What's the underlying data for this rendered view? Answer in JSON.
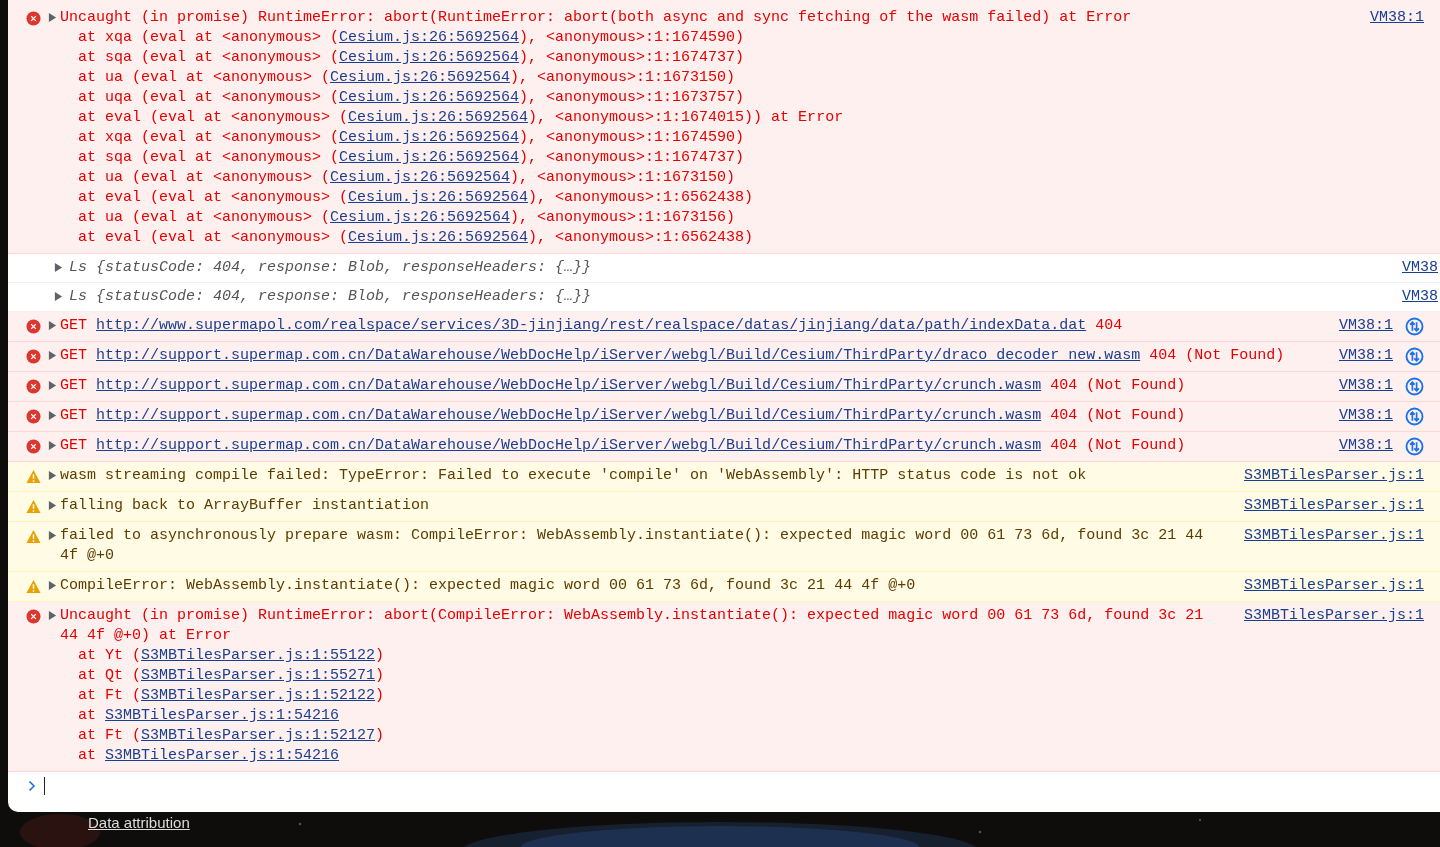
{
  "console": {
    "entries": [
      {
        "kind": "error",
        "message": "Uncaught (in promise) RuntimeError: abort(RuntimeError: abort(both async and sync fetching of the wasm failed) at Error",
        "source": "VM38:1",
        "stack": [
          {
            "prefix": "at xqa (eval at <anonymous> (",
            "link": "Cesium.js:26:5692564",
            "suffix": "), <anonymous>:1:1674590)"
          },
          {
            "prefix": "at sqa (eval at <anonymous> (",
            "link": "Cesium.js:26:5692564",
            "suffix": "), <anonymous>:1:1674737)"
          },
          {
            "prefix": "at ua (eval at <anonymous> (",
            "link": "Cesium.js:26:5692564",
            "suffix": "), <anonymous>:1:1673150)"
          },
          {
            "prefix": "at uqa (eval at <anonymous> (",
            "link": "Cesium.js:26:5692564",
            "suffix": "), <anonymous>:1:1673757)"
          },
          {
            "prefix": "at eval (eval at <anonymous> (",
            "link": "Cesium.js:26:5692564",
            "suffix": "), <anonymous>:1:1674015)) at Error"
          },
          {
            "prefix": "at xqa (eval at <anonymous> (",
            "link": "Cesium.js:26:5692564",
            "suffix": "), <anonymous>:1:1674590)"
          },
          {
            "prefix": "at sqa (eval at <anonymous> (",
            "link": "Cesium.js:26:5692564",
            "suffix": "), <anonymous>:1:1674737)"
          },
          {
            "prefix": "at ua (eval at <anonymous> (",
            "link": "Cesium.js:26:5692564",
            "suffix": "), <anonymous>:1:1673150)"
          },
          {
            "prefix": "at eval (eval at <anonymous> (",
            "link": "Cesium.js:26:5692564",
            "suffix": "), <anonymous>:1:6562438)"
          },
          {
            "prefix": "at ua (eval at <anonymous> (",
            "link": "Cesium.js:26:5692564",
            "suffix": "), <anonymous>:1:1673156)"
          },
          {
            "prefix": "at eval (eval at <anonymous> (",
            "link": "Cesium.js:26:5692564",
            "suffix": "), <anonymous>:1:6562438)"
          }
        ]
      },
      {
        "kind": "log",
        "message": "Ls {statusCode: 404, response: Blob, responseHeaders: {…}}",
        "source": "VM38"
      },
      {
        "kind": "log",
        "message": "Ls {statusCode: 404, response: Blob, responseHeaders: {…}}",
        "source": "VM38"
      },
      {
        "kind": "network",
        "method": "GET",
        "url": "http://www.supermapol.com/realspace/services/3D-jinjiang/rest/realspace/datas/jinjiang/data/path/indexData.dat",
        "status": "404",
        "source": "VM38:1"
      },
      {
        "kind": "network",
        "method": "GET",
        "url": "http://support.supermap.com.cn/DataWarehouse/WebDocHelp/iServer/webgl/Build/Cesium/ThirdParty/draco_decoder_new.wasm",
        "status": "404 (Not Found)",
        "source": "VM38:1"
      },
      {
        "kind": "network",
        "method": "GET",
        "url": "http://support.supermap.com.cn/DataWarehouse/WebDocHelp/iServer/webgl/Build/Cesium/ThirdParty/crunch.wasm",
        "status": "404 (Not Found)",
        "source": "VM38:1"
      },
      {
        "kind": "network",
        "method": "GET",
        "url": "http://support.supermap.com.cn/DataWarehouse/WebDocHelp/iServer/webgl/Build/Cesium/ThirdParty/crunch.wasm",
        "status": "404 (Not Found)",
        "source": "VM38:1"
      },
      {
        "kind": "network",
        "method": "GET",
        "url": "http://support.supermap.com.cn/DataWarehouse/WebDocHelp/iServer/webgl/Build/Cesium/ThirdParty/crunch.wasm",
        "status": "404 (Not Found)",
        "source": "VM38:1"
      },
      {
        "kind": "warning",
        "message": "wasm streaming compile failed: TypeError: Failed to execute 'compile' on 'WebAssembly': HTTP status code is not ok",
        "source": "S3MBTilesParser.js:1"
      },
      {
        "kind": "warning",
        "message": "falling back to ArrayBuffer instantiation",
        "source": "S3MBTilesParser.js:1"
      },
      {
        "kind": "warning",
        "message": "failed to asynchronously prepare wasm: CompileError: WebAssembly.instantiate(): expected magic word 00 61 73 6d, found 3c 21 44 4f @+0",
        "source": "S3MBTilesParser.js:1"
      },
      {
        "kind": "warning",
        "message": "CompileError: WebAssembly.instantiate(): expected magic word 00 61 73 6d, found 3c 21 44 4f @+0",
        "source": "S3MBTilesParser.js:1"
      },
      {
        "kind": "error",
        "message": "Uncaught (in promise) RuntimeError: abort(CompileError: WebAssembly.instantiate(): expected magic word 00 61 73 6d, found 3c 21 44 4f @+0) at Error",
        "source": "S3MBTilesParser.js:1",
        "stack": [
          {
            "prefix": "at Yt (",
            "link": "S3MBTilesParser.js:1:55122",
            "suffix": ")"
          },
          {
            "prefix": "at Qt (",
            "link": "S3MBTilesParser.js:1:55271",
            "suffix": ")"
          },
          {
            "prefix": "at Ft (",
            "link": "S3MBTilesParser.js:1:52122",
            "suffix": ")"
          },
          {
            "prefix": "at ",
            "link": "S3MBTilesParser.js:1:54216"
          },
          {
            "prefix": "at Ft (",
            "link": "S3MBTilesParser.js:1:52127",
            "suffix": ")"
          },
          {
            "prefix": "at ",
            "link": "S3MBTilesParser.js:1:54216"
          }
        ]
      }
    ]
  },
  "footer": {
    "link": "Data attribution"
  }
}
